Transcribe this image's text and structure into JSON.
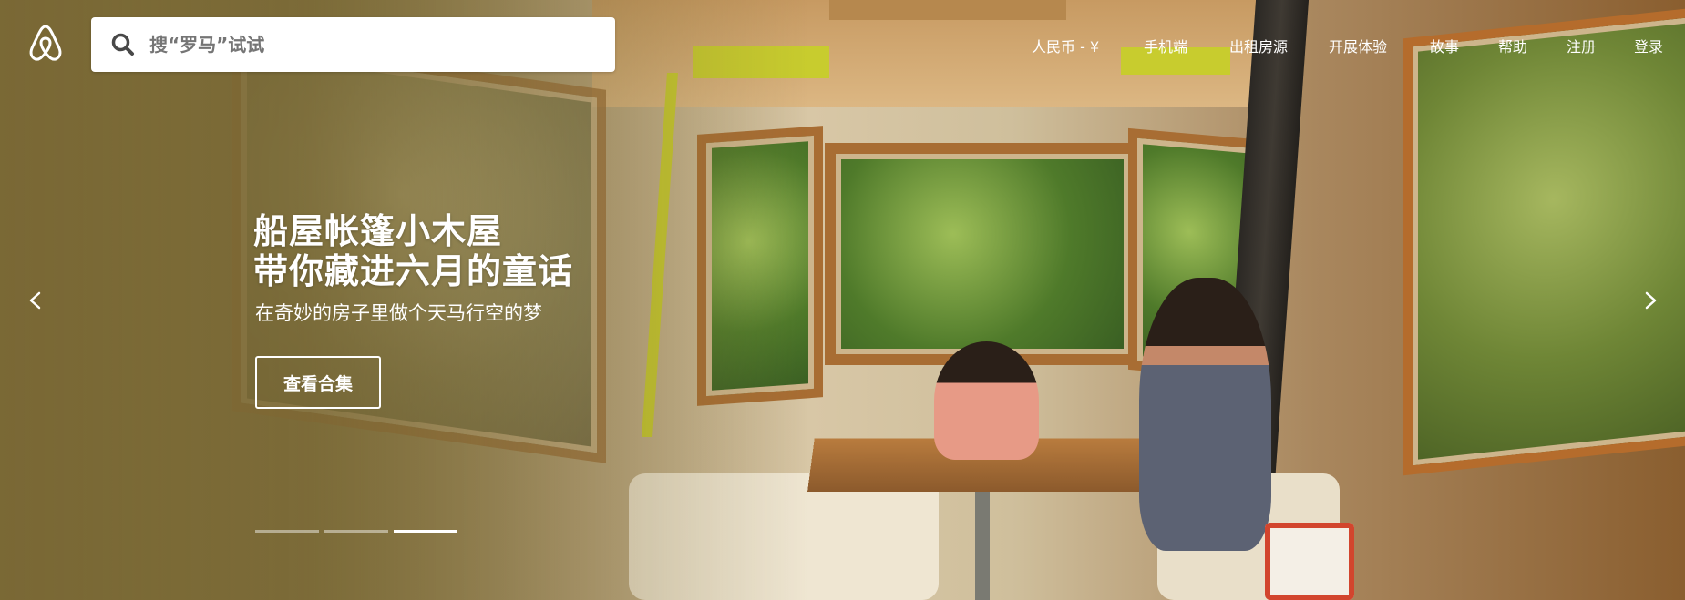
{
  "header": {
    "logo_icon": "airbnb-belo-icon",
    "search": {
      "icon": "search-icon",
      "placeholder": "搜“罗马”试试"
    },
    "nav": [
      {
        "label": "人民币 - ¥"
      },
      {
        "label": "手机端"
      },
      {
        "label": "出租房源"
      },
      {
        "label": "开展体验"
      },
      {
        "label": "故事"
      },
      {
        "label": "帮助"
      },
      {
        "label": "注册"
      },
      {
        "label": "登录"
      }
    ]
  },
  "hero": {
    "title_line1": "船屋帐篷小木屋",
    "title_line2": "带你藏进六月的童话",
    "subtitle": "在奇妙的房子里做个天马行空的梦",
    "cta_label": "查看合集",
    "prev_icon": "chevron-left-icon",
    "next_icon": "chevron-right-icon",
    "slides_total": 3,
    "active_slide": 3
  },
  "colors": {
    "overlay": "#78673a",
    "accent": "#ffffff"
  }
}
